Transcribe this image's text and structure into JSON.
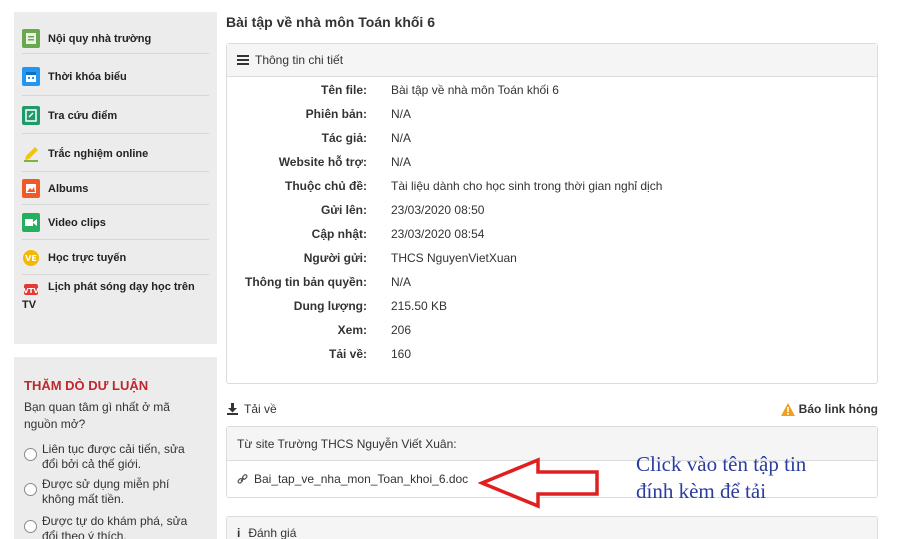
{
  "sidebar": {
    "menu": [
      {
        "label": "Nội quy nhà trường",
        "icon": "rules-book-icon",
        "color": "#6aa84f"
      },
      {
        "label": "Thời khóa biểu",
        "icon": "calendar-icon",
        "color": "#2196f3"
      },
      {
        "label": "Tra cứu điểm",
        "icon": "edit-note-icon",
        "color": "#1e9a6b"
      },
      {
        "label": "Trắc nghiệm online",
        "icon": "pencil-icon",
        "color": "#f1c40f"
      },
      {
        "label": "Albums",
        "icon": "album-icon",
        "color": "#f05a28"
      },
      {
        "label": "Video clips",
        "icon": "video-icon",
        "color": "#27ae60"
      },
      {
        "label": "Học trực tuyến",
        "icon": "online-learning-icon",
        "color": "#f5b700"
      },
      {
        "label": "Lịch phát sóng dạy học trên TV",
        "icon": "tv-schedule-icon",
        "color": "#e53935"
      }
    ],
    "survey": {
      "title": "THĂM DÒ DƯ LUẬN",
      "question": "Bạn quan tâm gì nhất ở mã nguồn mở?",
      "options": [
        "Liên tục được cải tiến, sửa đổi bởi cả thế giới.",
        "Được sử dụng miễn phí không mất tiền.",
        "Được tự do khám phá, sửa đổi theo ý thích."
      ]
    }
  },
  "main": {
    "title": "Bài tập về nhà môn Toán khối 6",
    "details_panel": {
      "heading": "Thông tin chi tiết",
      "rows": [
        {
          "label": "Tên file:",
          "value": "Bài tập về nhà môn Toán khối 6"
        },
        {
          "label": "Phiên bản:",
          "value": "N/A"
        },
        {
          "label": "Tác giả:",
          "value": "N/A"
        },
        {
          "label": "Website hỗ trợ:",
          "value": "N/A"
        },
        {
          "label": "Thuộc chủ đề:",
          "value": "Tài liệu dành cho học sinh trong thời gian nghỉ dịch"
        },
        {
          "label": "Gửi lên:",
          "value": "23/03/2020 08:50"
        },
        {
          "label": "Cập nhật:",
          "value": "23/03/2020 08:54"
        },
        {
          "label": "Người gửi:",
          "value": "THCS NguyenVietXuan"
        },
        {
          "label": "Thông tin bản quyền:",
          "value": "N/A"
        },
        {
          "label": "Dung lượng:",
          "value": "215.50 KB"
        },
        {
          "label": "Xem:",
          "value": "206"
        },
        {
          "label": "Tải về:",
          "value": "160"
        }
      ]
    },
    "download": {
      "heading": "Tải về",
      "report_link": "Báo link hỏng",
      "source_label": "Từ site Trường THCS Nguyễn Viết Xuân:",
      "file_link": "Bai_tap_ve_nha_mon_Toan_khoi_6.doc"
    },
    "rating_panel": {
      "heading": "Đánh giá"
    }
  },
  "annotation": {
    "text_line1": "Click vào tên tập tin",
    "text_line2": "đính kèm để tải",
    "text_color": "#2a3c9e",
    "arrow_color": "#e0201f"
  }
}
